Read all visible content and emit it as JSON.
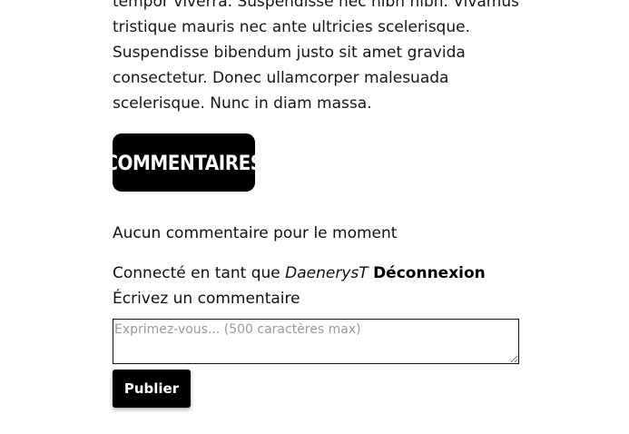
{
  "article": {
    "text": "tempor viverra. Suspendisse nec nibh nibh. Vivamus\ntristique mauris nec ante ultricies scelerisque.\nSuspendisse bibendum justo sit amet gravida\nconsectetur. Donec ullamcorper malesuada\nscelerisque. Nunc in diam massa."
  },
  "comments": {
    "heading": "COMMENTAIRES",
    "empty_message": "Aucun commentaire pour le moment",
    "logged_in_prefix": "Connecté en tant que",
    "username": "DaenerysT",
    "logout_label": "Déconnexion",
    "write_label": "Écrivez un commentaire",
    "input_placeholder": "Exprimez-vous... (500 caractères max)",
    "input_value": "",
    "publish_label": "Publier"
  },
  "colors": {
    "button_bg": "#000000",
    "button_text": "#ffffff",
    "text": "#111111"
  }
}
